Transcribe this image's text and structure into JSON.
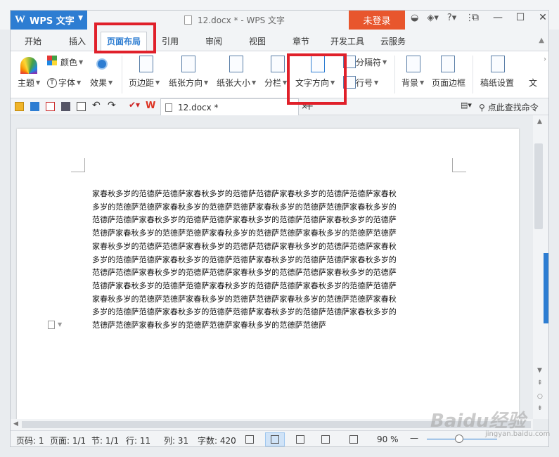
{
  "titlebar": {
    "app_name": "WPS 文字",
    "doc_title": "12.docx * - WPS 文字",
    "login_label": "未登录",
    "help_label": "?"
  },
  "tabs": [
    "开始",
    "插入",
    "页面布局",
    "引用",
    "审阅",
    "视图",
    "章节",
    "开发工具",
    "云服务"
  ],
  "active_tab": "页面布局",
  "ribbon": {
    "theme": "主题",
    "color": "颜色",
    "font": "字体",
    "effect": "效果",
    "margin": "页边距",
    "orientation": "纸张方向",
    "size": "纸张大小",
    "columns": "分栏",
    "text_direction": "文字方向",
    "break": "分隔符",
    "line_number": "行号",
    "background": "背景",
    "border": "页面边框",
    "manuscript": "稿纸设置",
    "more": "文"
  },
  "quickbar": {
    "doc_tab": "12.docx *",
    "find": "点此查找命令"
  },
  "document": {
    "lines": [
      "家春秋多岁的范德萨范德萨家春秋多岁的范德萨范德萨家春秋多岁的范德萨范德萨家春秋",
      "多岁的范德萨范德萨家春秋多岁的范德萨范德萨家春秋多岁的范德萨范德萨家春秋多岁的",
      "范德萨范德萨家春秋多岁的范德萨范德萨家春秋多岁的范德萨范德萨家春秋多岁的范德萨",
      "范德萨家春秋多岁的范德萨范德萨家春秋多岁的范德萨范德萨家春秋多岁的范德萨范德萨",
      "家春秋多岁的范德萨范德萨家春秋多岁的范德萨范德萨家春秋多岁的范德萨范德萨家春秋",
      "多岁的范德萨范德萨家春秋多岁的范德萨范德萨家春秋多岁的范德萨范德萨家春秋多岁的",
      "范德萨范德萨家春秋多岁的范德萨范德萨家春秋多岁的范德萨范德萨家春秋多岁的范德萨",
      "范德萨家春秋多岁的范德萨范德萨家春秋多岁的范德萨范德萨家春秋多岁的范德萨范德萨",
      "家春秋多岁的范德萨范德萨家春秋多岁的范德萨范德萨家春秋多岁的范德萨范德萨家春秋",
      "多岁的范德萨范德萨家春秋多岁的范德萨范德萨家春秋多岁的范德萨范德萨家春秋多岁的",
      "范德萨范德萨家春秋多岁的范德萨范德萨家春秋多岁的范德萨范德萨"
    ]
  },
  "status": {
    "page_code": "页码: 1",
    "page": "页面: 1/1",
    "section": "节: 1/1",
    "row": "行: 11",
    "col": "列: 31",
    "words": "字数: 420",
    "zoom": "90 %"
  },
  "watermark": {
    "brand": "Baidu经验",
    "url": "jingyan.baidu.com"
  },
  "colors": {
    "accent": "#2d7dd2",
    "login": "#e8562d",
    "highlight": "#e0202a"
  }
}
